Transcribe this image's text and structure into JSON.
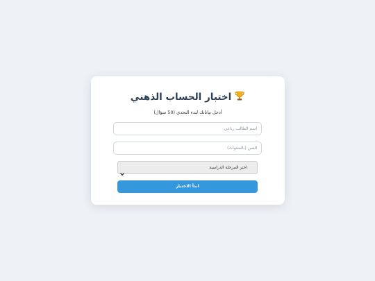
{
  "page": {
    "title": "اختبار الحساب الذهني",
    "title_icon": "trophy-icon",
    "subtitle": "أدخل بياناتك لبدء التحدي (50 سؤال)"
  },
  "form": {
    "name": {
      "value": "",
      "placeholder": "اسم الطالب رباعي"
    },
    "age": {
      "value": "",
      "placeholder": "السن (بالسنوات)"
    },
    "stage": {
      "selected": "اختر المرحلة الدراسية"
    },
    "start_label": "ابدأ الاختبار"
  },
  "colors": {
    "background": "#eef2f6",
    "card": "#ffffff",
    "accent": "#3598dc",
    "title": "#2c3e50"
  }
}
